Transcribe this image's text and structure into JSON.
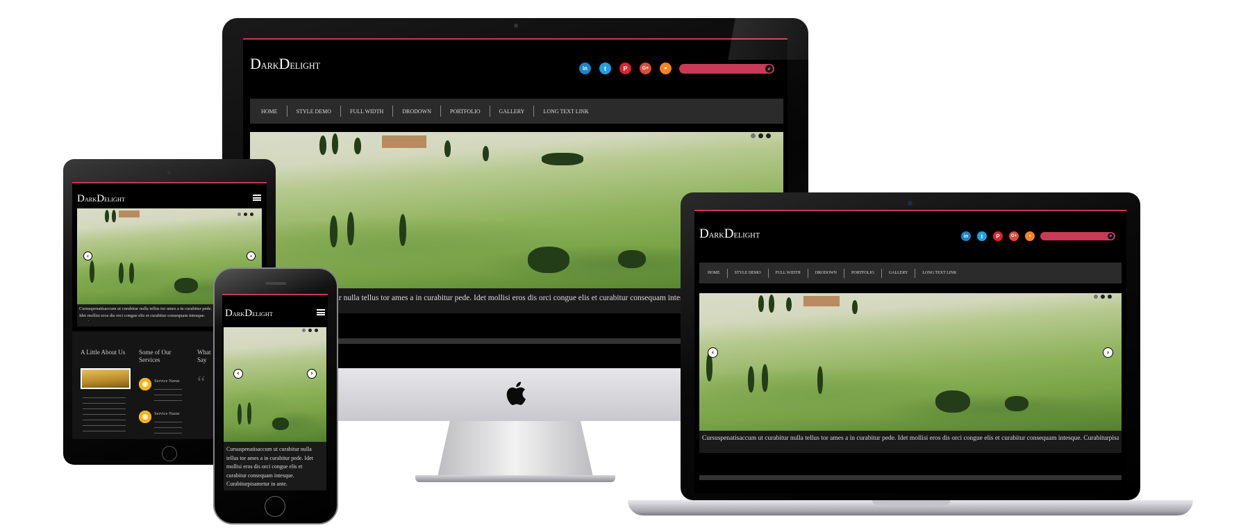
{
  "site": {
    "logo": {
      "first_big": "D",
      "first_small": "ark",
      "second_big": "D",
      "second_small": "elight"
    },
    "social_icons": [
      {
        "name": "linkedin-icon",
        "glyph": "in",
        "color": "#1b84c6"
      },
      {
        "name": "twitter-icon",
        "glyph": "t",
        "color": "#1da1e0"
      },
      {
        "name": "pinterest-icon",
        "glyph": "P",
        "color": "#d8262c"
      },
      {
        "name": "google-plus-icon",
        "glyph": "G+",
        "color": "#dd4b39"
      },
      {
        "name": "rss-icon",
        "glyph": "●",
        "color": "#f5831f"
      }
    ],
    "nav": [
      "HOME",
      "STYLE DEMO",
      "FULL WIDTH",
      "DRODOWN",
      "PORTFOLIO",
      "GALLERY",
      "LONG TEXT LINK"
    ],
    "caption_imac": "bitur nulla tellus tor ames a in curabitur pede. Idet mollisi eros dis orci congue elis et curabitur consequam intesque",
    "caption_laptop": "Cursuspenatisaccum ut curabitur nulla tellus tor ames a in curabitur pede. Idet mollisi eros dis orci congue elis et curabitur consequam intesque. Curabiturpisametur in ante.",
    "caption_tablet": "Cursuspenatisaccum ut curabitur nulla tellus tor ames a in curabitur pede. Idet mollisi eros dis orci congue elis et curabitur consequam intesque. Curabitu",
    "caption_phone": "Cursuspenatisaccum ut curabitur nulla tellus tor ames a in curabitur pede. Idet mollisi eros dis orci congue elis et curabitur consequam intesque. Curabiturpisametur in ante.",
    "sections": {
      "about_title": "A Little About Us",
      "services_title": "Some of Our Services",
      "say_title": "What Say",
      "service_name_1": "Service Name",
      "service_name_2": "Service Name"
    },
    "colors": {
      "accent": "#c83a55",
      "nav_bg": "#2b2b2b",
      "background": "#000000"
    }
  }
}
